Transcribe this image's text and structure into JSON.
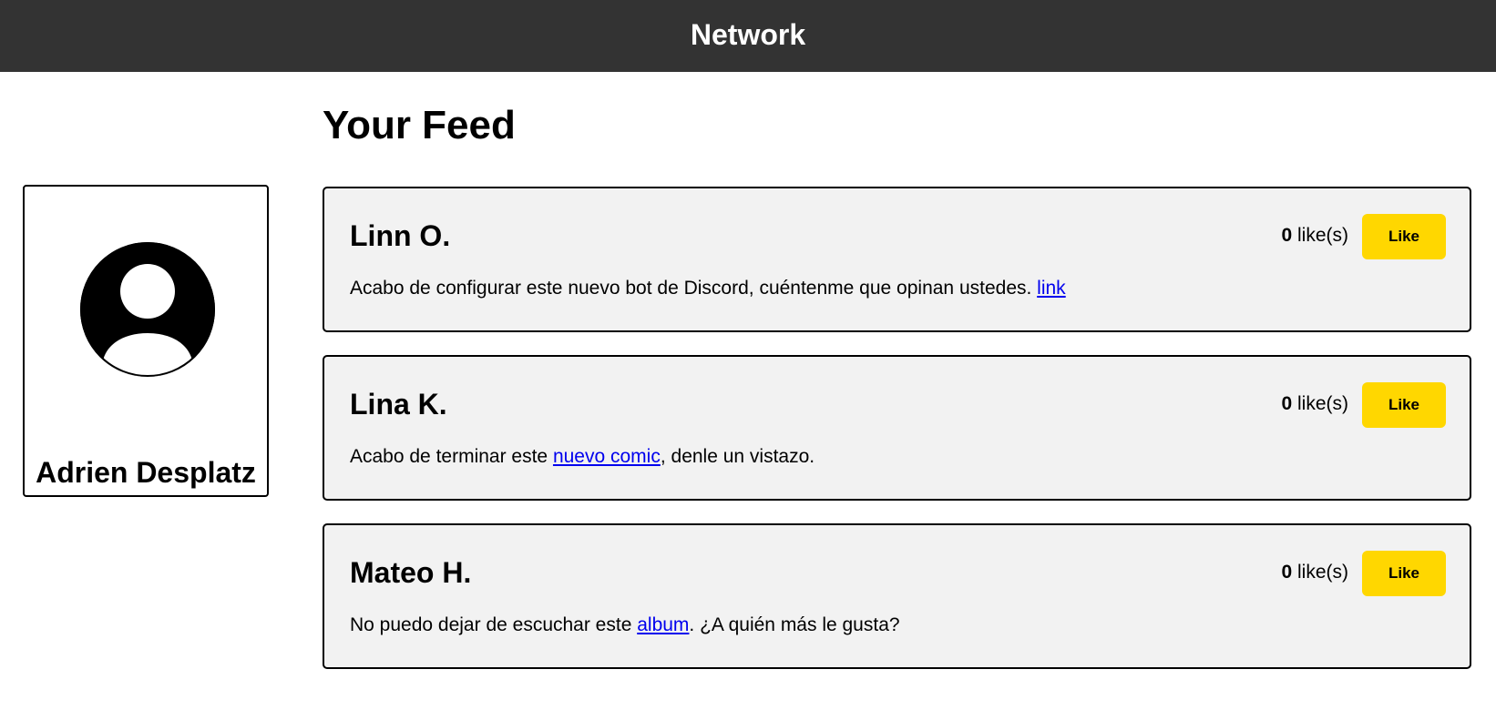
{
  "header": {
    "title": "Network"
  },
  "profile": {
    "name": "Adrien Desplatz",
    "avatar_icon": "user-circle-icon"
  },
  "feed": {
    "title": "Your Feed",
    "like_suffix": " like(s)",
    "like_button_label": "Like",
    "posts": [
      {
        "author": "Linn O.",
        "likes": "0",
        "text_before": "Acabo de configurar este nuevo bot de Discord, cuéntenme que opinan ustedes. ",
        "link_text": "link",
        "text_after": ""
      },
      {
        "author": "Lina K.",
        "likes": "0",
        "text_before": "Acabo de terminar este ",
        "link_text": "nuevo comic",
        "text_after": ", denle un vistazo."
      },
      {
        "author": "Mateo H.",
        "likes": "0",
        "text_before": "No puedo dejar de escuchar este ",
        "link_text": "album",
        "text_after": ". ¿A quién más le gusta?"
      }
    ]
  },
  "colors": {
    "header_bg": "#333333",
    "card_bg": "#f2f2f2",
    "like_button_bg": "#ffd700",
    "link": "#0000ee"
  }
}
